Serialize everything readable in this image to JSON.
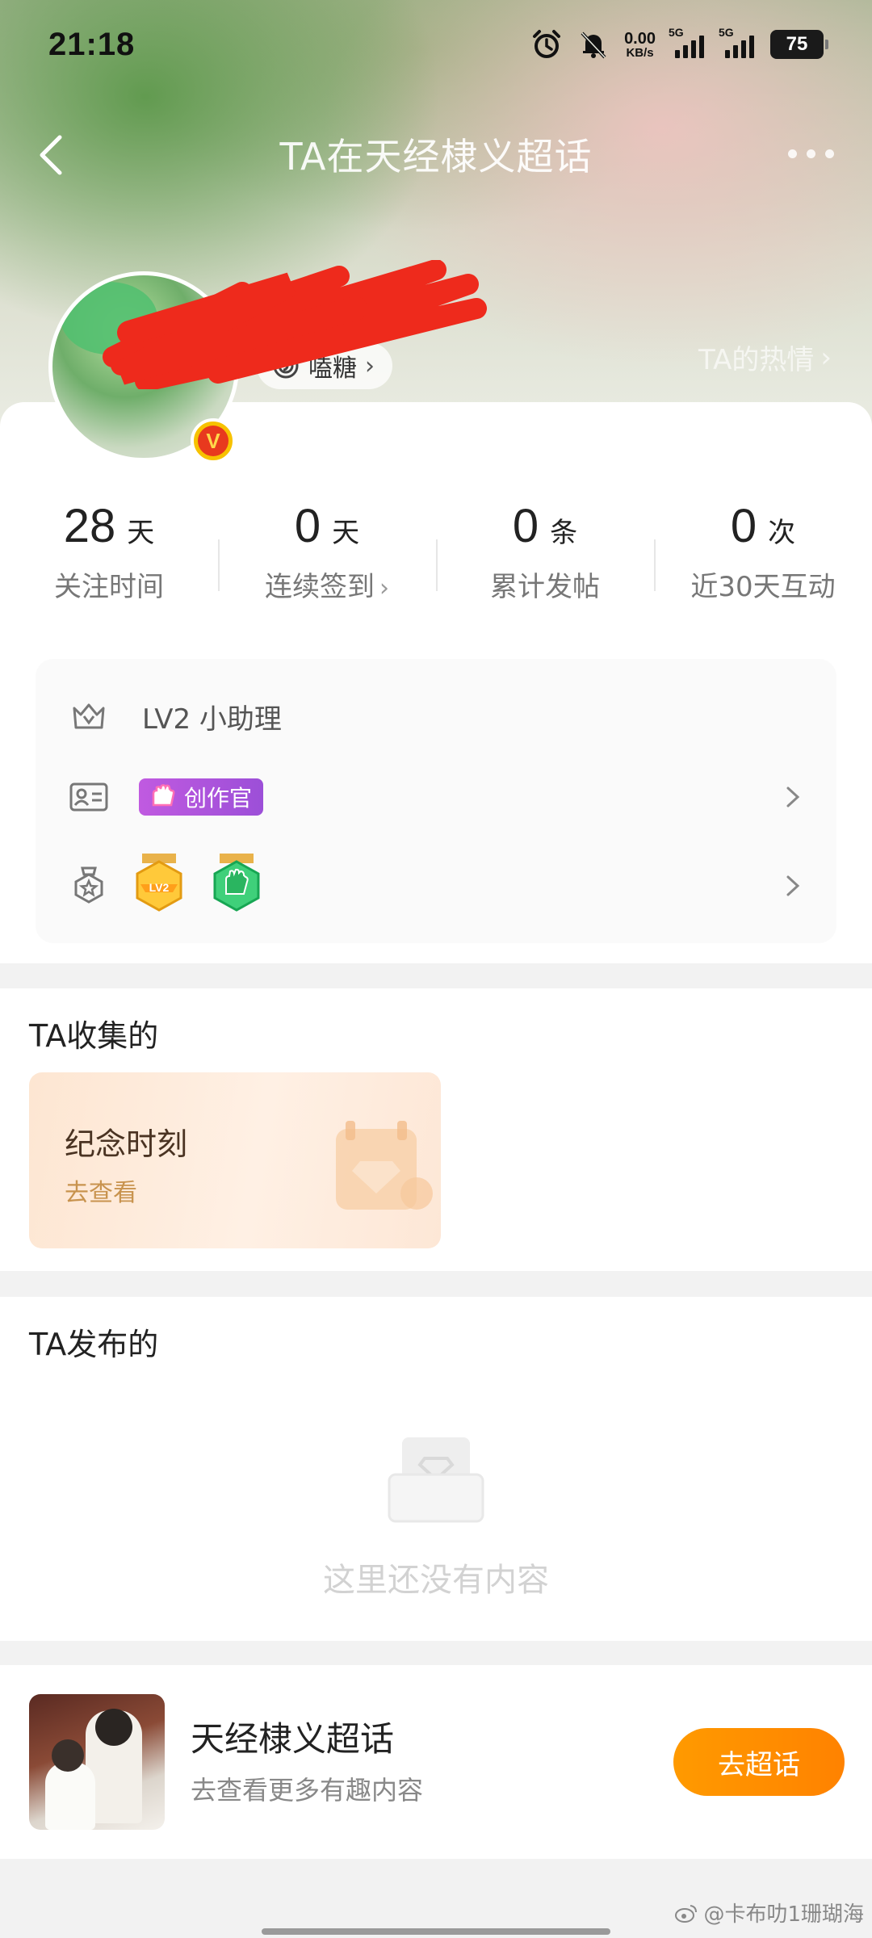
{
  "status_bar": {
    "time": "21:18",
    "net_speed_value": "0.00",
    "net_speed_unit": "KB/s",
    "signal1_label": "5G",
    "signal2_label": "5G",
    "battery": "75"
  },
  "nav": {
    "title": "TA在天经棣义超话"
  },
  "profile": {
    "tag_label": "嗑糖",
    "ta_link": "TA的热情",
    "vip_letter": "V"
  },
  "stats": [
    {
      "num": "28",
      "unit": "天",
      "label": "关注时间"
    },
    {
      "num": "0",
      "unit": "天",
      "label": "连续签到"
    },
    {
      "num": "0",
      "unit": "条",
      "label": "累计发帖"
    },
    {
      "num": "0",
      "unit": "次",
      "label": "近30天互动"
    }
  ],
  "info": {
    "level": "LV2 小助理",
    "creator_badge": "创作官",
    "medal1_text": "LV2"
  },
  "collected": {
    "title": "TA收集的",
    "card_title": "纪念时刻",
    "card_link": "去查看"
  },
  "posted": {
    "title": "TA发布的",
    "empty": "这里还没有内容"
  },
  "topic": {
    "name": "天经棣义超话",
    "subtitle": "去查看更多有趣内容",
    "button": "去超话"
  },
  "watermark": "@卡布叻1珊瑚海",
  "colors": {
    "accent_orange": "#ff8c00",
    "creator_purple": "#b055de",
    "vip_red": "#e8391e",
    "vip_gold": "#f7c200"
  }
}
